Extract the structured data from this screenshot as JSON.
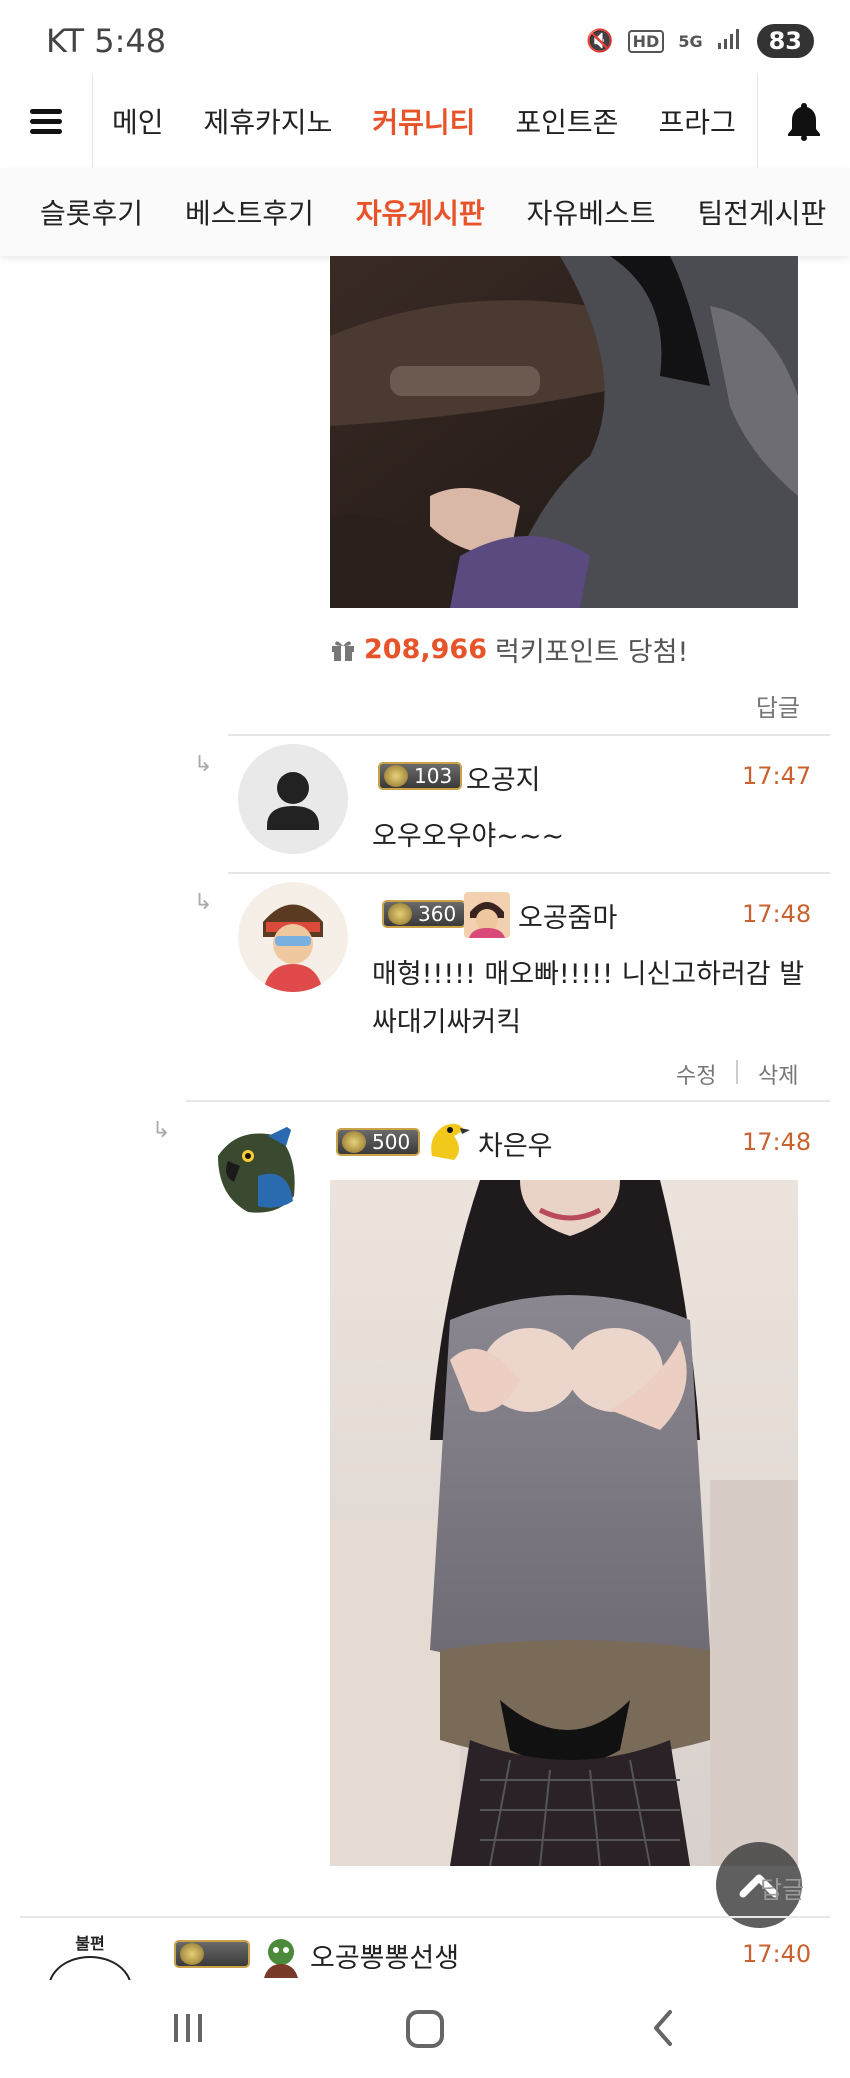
{
  "status_bar": {
    "carrier_time": "KT 5:48",
    "battery": "83",
    "icons": [
      "mute-icon",
      "hd-icon",
      "5g-icon",
      "signal-icon"
    ]
  },
  "main_nav": {
    "tabs": [
      "메인",
      "제휴카지노",
      "커뮤니티",
      "포인트존",
      "프라그"
    ],
    "active": "커뮤니티"
  },
  "sub_nav": {
    "tabs": [
      "슬롯후기",
      "베스트후기",
      "자유게시판",
      "자유베스트",
      "팀전게시판"
    ],
    "active": "자유게시판"
  },
  "post": {
    "lucky_points": "208,966",
    "lucky_text": "럭키포인트 당첨!",
    "reply_label": "답글"
  },
  "comments": [
    {
      "level": "103",
      "name": "오공지",
      "time": "17:47",
      "text": "오우오우야~~~"
    },
    {
      "level": "360",
      "name": "오공줌마",
      "time": "17:48",
      "text_line1": "매형!!!!! 매오빠!!!!! 니신고하러감 발",
      "text_line2": "싸대기싸커킥",
      "edit_label": "수정",
      "delete_label": "삭제"
    },
    {
      "level": "500",
      "name": "차은우",
      "time": "17:48"
    },
    {
      "name": "오공뽕뽕선생",
      "time": "17:40",
      "avatar_text": "불편"
    }
  ],
  "overlay_reply_label": "답글",
  "colors": {
    "accent": "#e8542a",
    "time": "#c9622f",
    "gray_text": "#777777"
  }
}
